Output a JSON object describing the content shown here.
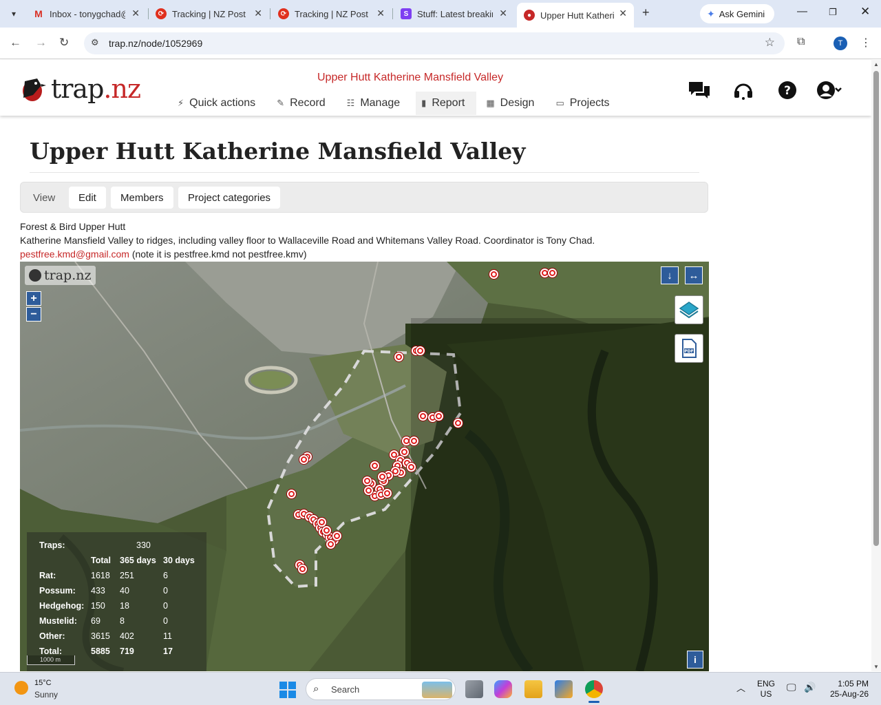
{
  "browser": {
    "tabs": [
      {
        "title": "Inbox - tonygchad@",
        "favicon": "gmail-icon",
        "color": "#d93025",
        "active": false
      },
      {
        "title": "Tracking | NZ Post",
        "favicon": "nzpost-icon",
        "color": "#e0301e",
        "active": false
      },
      {
        "title": "Tracking | NZ Post",
        "favicon": "nzpost-icon",
        "color": "#e0301e",
        "active": false
      },
      {
        "title": "Stuff: Latest breakin",
        "favicon": "stuff-icon",
        "color": "#7e3ff2",
        "active": false
      },
      {
        "title": "Upper Hutt Katherin",
        "favicon": "trapnz-icon",
        "color": "#c62828",
        "active": true
      }
    ],
    "gemini_label": "Ask Gemini",
    "url": "trap.nz/node/1052969",
    "profile_initial": "T"
  },
  "site": {
    "logo_text": "trap",
    "logo_dot": ".",
    "logo_tld": "nz",
    "project_name": "Upper Hutt Katherine Mansfield Valley",
    "nav": [
      {
        "label": "Quick actions",
        "icon": "⚡",
        "active": false
      },
      {
        "label": "Record",
        "icon": "✎",
        "active": false
      },
      {
        "label": "Manage",
        "icon": "☷",
        "active": false
      },
      {
        "label": "Report",
        "icon": "▮",
        "active": true
      },
      {
        "label": "Design",
        "icon": "▦",
        "active": false
      },
      {
        "label": "Projects",
        "icon": "▭",
        "active": false
      }
    ]
  },
  "page": {
    "title": "Upper Hutt Katherine Mansfield Valley",
    "subtabs": {
      "view": "View",
      "edit": "Edit",
      "members": "Members",
      "categories": "Project categories"
    },
    "desc_line1": "Forest & Bird Upper Hutt",
    "desc_line2": "Katherine Mansfield Valley to ridges, including valley floor to Wallaceville Road and Whitemans Valley Road. Coordinator is Tony Chad.",
    "email": "pestfree.kmd@gmail.com",
    "email_note": " (note it is pestfree.kmd not pestfree.kmv)"
  },
  "map": {
    "logo_text": "trap.nz",
    "zoom_in": "+",
    "zoom_out": "−",
    "scale_label": "1000 m",
    "info_label": "i",
    "stats": {
      "traps_label": "Traps:",
      "traps_total": "330",
      "headers": [
        "Total",
        "365 days",
        "30 days"
      ],
      "rows": [
        {
          "label": "Rat:",
          "total": "1618",
          "y365": "251",
          "d30": "6"
        },
        {
          "label": "Possum:",
          "total": "433",
          "y365": "40",
          "d30": "0"
        },
        {
          "label": "Hedgehog:",
          "total": "150",
          "y365": "18",
          "d30": "0"
        },
        {
          "label": "Mustelid:",
          "total": "69",
          "y365": "8",
          "d30": "0"
        },
        {
          "label": "Other:",
          "total": "3615",
          "y365": "402",
          "d30": "11"
        },
        {
          "label": "Total:",
          "total": "5885",
          "y365": "719",
          "d30": "17"
        }
      ]
    }
  },
  "taskbar": {
    "temp": "15°C",
    "condition": "Sunny",
    "search_label": "Search",
    "lang_top": "ENG",
    "lang_bottom": "US",
    "time": "1:05 PM",
    "date": "25-Aug-26"
  }
}
